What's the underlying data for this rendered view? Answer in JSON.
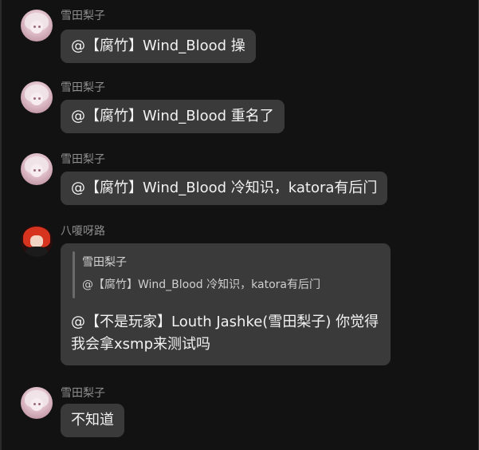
{
  "messages": [
    {
      "sender": "雪田梨子",
      "text": "@【腐竹】Wind_Blood 操"
    },
    {
      "sender": "雪田梨子",
      "text": "@【腐竹】Wind_Blood 重名了"
    },
    {
      "sender": "雪田梨子",
      "text": "@【腐竹】Wind_Blood 冷知识，katora有后门"
    },
    {
      "sender": "八嗄呀路",
      "quote": {
        "sender": "雪田梨子",
        "text": "@【腐竹】Wind_Blood 冷知识，katora有后门"
      },
      "text_line1": "@【不是玩家】Louth Jashke(雪田梨子)   你觉得",
      "text_line2": "我会拿xsmp来测试吗"
    },
    {
      "sender": "雪田梨子",
      "text": "不知道"
    }
  ],
  "colors": {
    "background": "#121212",
    "bubble": "#3a3a3a",
    "sender_text": "#8f8f8f",
    "message_text": "#f2f2f2"
  },
  "icons": [
    "avatar-pink-hair-girl",
    "avatar-red-hair-character"
  ]
}
